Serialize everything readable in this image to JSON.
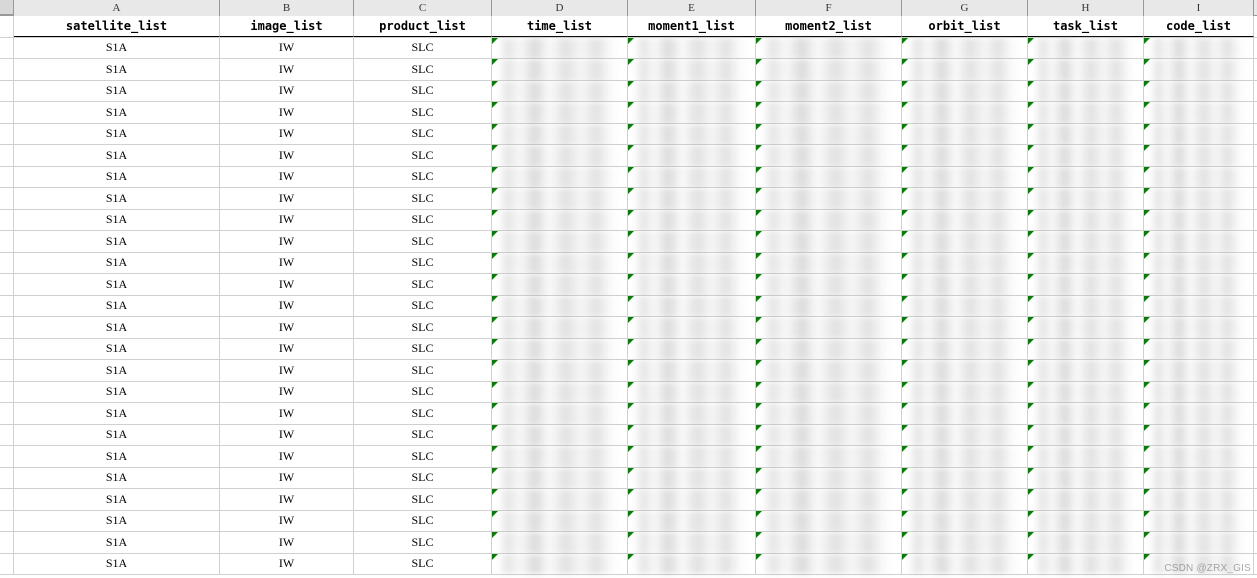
{
  "column_labels": [
    "A",
    "B",
    "C",
    "D",
    "E",
    "F",
    "G",
    "H",
    "I"
  ],
  "headers": {
    "A": "satellite_list",
    "B": "image_list",
    "C": "product_list",
    "D": "time_list",
    "E": "moment1_list",
    "F": "moment2_list",
    "G": "orbit_list",
    "H": "task_list",
    "I": "code_list"
  },
  "row_count": 25,
  "satellite_value": "S1A",
  "image_value": "IW",
  "product_value": "SLC",
  "blurred_columns": [
    "D",
    "E",
    "F",
    "G",
    "H",
    "I"
  ],
  "watermark": "CSDN @ZRX_GIS"
}
